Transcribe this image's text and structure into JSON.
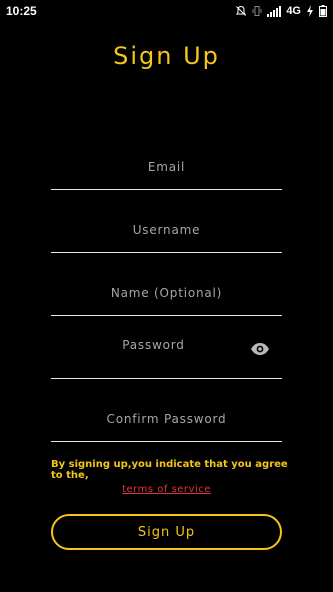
{
  "status_bar": {
    "time": "10:25",
    "network": "4G",
    "icons": [
      "mute-icon",
      "vibrate-icon",
      "signal-icon",
      "charging-icon"
    ]
  },
  "title": "Sign Up",
  "fields": {
    "email": {
      "label": "Email",
      "value": ""
    },
    "username": {
      "label": "Username",
      "value": ""
    },
    "name": {
      "label": "Name (Optional)",
      "value": ""
    },
    "password": {
      "label": "Password",
      "value": "",
      "toggle_icon": "eye-icon"
    },
    "confirm_password": {
      "label": "Confirm Password",
      "value": ""
    }
  },
  "agreement": {
    "text": "By signing up,you indicate that you agree to the,",
    "link": "terms of service"
  },
  "button": {
    "label": "Sign Up"
  },
  "colors": {
    "background": "#000000",
    "accent": "#f5c518",
    "label": "#a6a6a6",
    "underline": "#e8e8e8",
    "link": "#e0343a"
  }
}
